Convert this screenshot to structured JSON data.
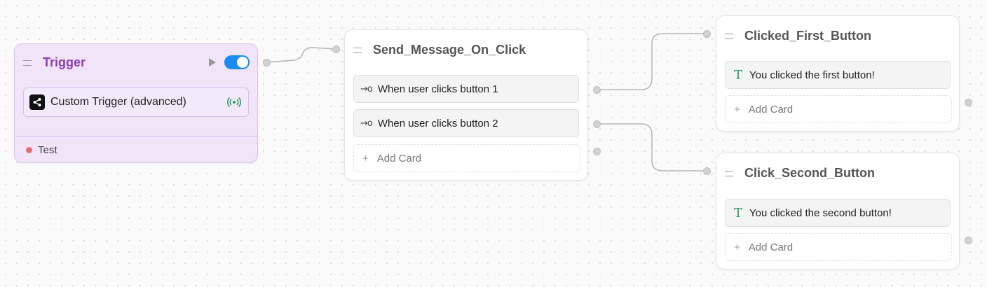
{
  "trigger": {
    "title": "Trigger",
    "enabled": true,
    "card_label": "Custom Trigger (advanced)",
    "status": "Test",
    "status_color": "#e46e74",
    "accent": "#8a3fb3",
    "toggle_color": "#1a8cf0"
  },
  "send_message": {
    "title": "Send_Message_On_Click",
    "cards": [
      {
        "label": "When user clicks button 1",
        "icon": "branch-arrow-icon"
      },
      {
        "label": "When user clicks button 2",
        "icon": "branch-arrow-icon"
      }
    ],
    "add_card": "Add Card"
  },
  "clicked_first": {
    "title": "Clicked_First_Button",
    "card_label": "You clicked the first button!",
    "card_icon": "text-icon",
    "add_card": "Add Card"
  },
  "click_second": {
    "title": "Click_Second_Button",
    "card_label": "You clicked the second button!",
    "card_icon": "text-icon",
    "add_card": "Add Card"
  },
  "icons": {
    "text_glyph": "T",
    "arrow_glyph": "→o",
    "plus_glyph": "+"
  }
}
